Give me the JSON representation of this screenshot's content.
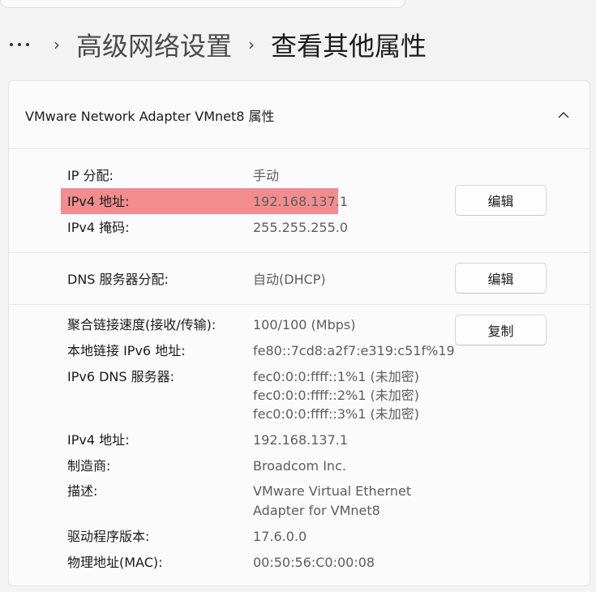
{
  "breadcrumb": {
    "prev": "高级网络设置",
    "current": "查看其他属性"
  },
  "card": {
    "title": "VMware Network Adapter VMnet8 属性"
  },
  "ip_section": {
    "rows": [
      {
        "label": "IP 分配:",
        "value": "手动"
      },
      {
        "label": "IPv4 地址:",
        "value": "192.168.137.1"
      },
      {
        "label": "IPv4 掩码:",
        "value": "255.255.255.0"
      }
    ],
    "button": "编辑"
  },
  "dns_section": {
    "label": "DNS 服务器分配:",
    "value": "自动(DHCP)",
    "button": "编辑"
  },
  "info_section": {
    "button": "复制",
    "speed_label": "聚合链接速度(接收/传输):",
    "speed_value": "100/100 (Mbps)",
    "ipv6_label": "本地链接 IPv6 地址:",
    "ipv6_value": "fe80::7cd8:a2f7:e319:c51f%19",
    "ipv6dns_label": "IPv6 DNS 服务器:",
    "ipv6dns_values": [
      "fec0:0:0:ffff::1%1 (未加密)",
      "fec0:0:0:ffff::2%1 (未加密)",
      "fec0:0:0:ffff::3%1 (未加密)"
    ],
    "ipv4_label": "IPv4 地址:",
    "ipv4_value": "192.168.137.1",
    "maker_label": "制造商:",
    "maker_value": "Broadcom Inc.",
    "desc_label": "描述:",
    "desc_values": [
      "VMware Virtual Ethernet",
      "Adapter for VMnet8"
    ],
    "driver_label": "驱动程序版本:",
    "driver_value": "17.6.0.0",
    "mac_label": "物理地址(MAC):",
    "mac_value": "00:50:56:C0:00:08"
  },
  "highlight_color": "#f28c8f"
}
